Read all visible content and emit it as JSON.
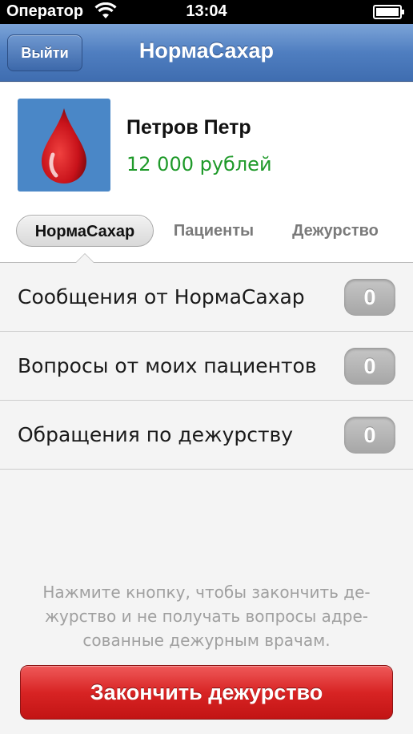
{
  "status_bar": {
    "carrier": "Оператор",
    "time": "13:04",
    "wifi_icon": "wifi-icon",
    "battery_icon": "battery-icon"
  },
  "nav": {
    "back_label": "Выйти",
    "title": "НормаСахар"
  },
  "profile": {
    "avatar_icon": "blood-drop-icon",
    "name": "Петров Петр",
    "balance": "12 000 рублей"
  },
  "tabs": [
    {
      "label": "НормаСахар",
      "active": true
    },
    {
      "label": "Пациенты",
      "active": false
    },
    {
      "label": "Дежурство",
      "active": false
    }
  ],
  "rows": [
    {
      "label": "Сообщения от НормаСахар",
      "count": "0"
    },
    {
      "label": "Вопросы от моих пациентов",
      "count": "0"
    },
    {
      "label": "Обращения по дежурству",
      "count": "0"
    }
  ],
  "hint": {
    "line1": "Нажмите кнопку, чтобы закончить де-",
    "line2": "журство и не получать вопросы адре-",
    "line3": "сованные дежурным врачам."
  },
  "end_button_label": "Закончить дежурство",
  "colors": {
    "nav_blue": "#4f7ec0",
    "balance_green": "#1f9a2a",
    "danger_red": "#d82424",
    "badge_gray": "#b0b0b0"
  }
}
